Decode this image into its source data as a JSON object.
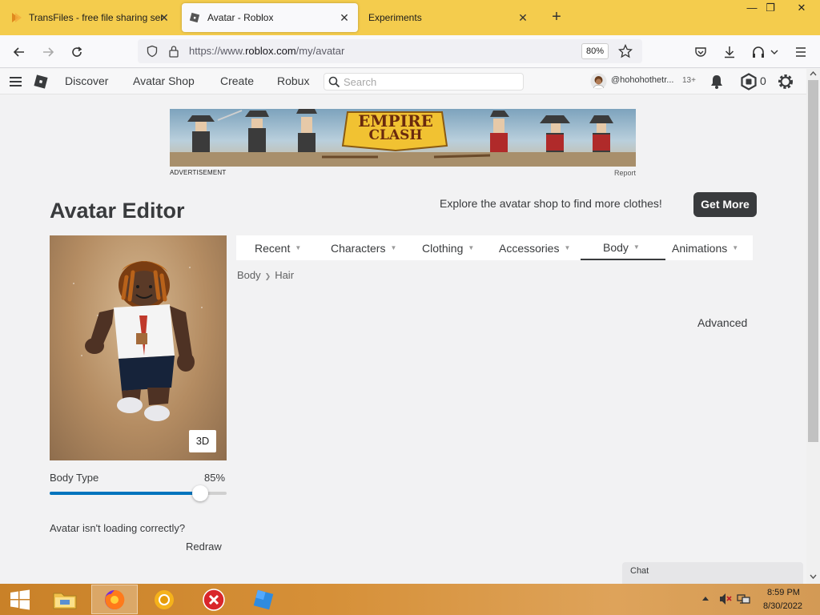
{
  "browser": {
    "tabs": [
      {
        "title": "TransFiles - free file sharing serv"
      },
      {
        "title": "Avatar - Roblox"
      },
      {
        "title": "Experiments"
      }
    ],
    "url_prefix": "https://www.",
    "url_host": "roblox.com",
    "url_path": "/my/avatar",
    "zoom": "80%"
  },
  "header": {
    "nav": [
      "Discover",
      "Avatar Shop",
      "Create",
      "Robux"
    ],
    "search_placeholder": "Search",
    "username": "@hohohothetr...",
    "age_badge": "13+",
    "robux_count": "0"
  },
  "ad": {
    "label": "ADVERTISEMENT",
    "report": "Report",
    "logo_line1": "EMPIRE",
    "logo_line2": "CLASH"
  },
  "editor": {
    "title": "Avatar Editor",
    "promo": "Explore the avatar shop to find more clothes!",
    "get_more": "Get More",
    "view_mode": "3D",
    "categories": [
      {
        "label": "Recent",
        "active": false
      },
      {
        "label": "Characters",
        "active": false
      },
      {
        "label": "Clothing",
        "active": false
      },
      {
        "label": "Accessories",
        "active": false
      },
      {
        "label": "Body",
        "active": true
      },
      {
        "label": "Animations",
        "active": false
      }
    ],
    "breadcrumb": [
      "Body",
      "Hair"
    ],
    "advanced": "Advanced",
    "body_type": {
      "label": "Body Type",
      "value_text": "85%",
      "value": 0.85
    },
    "loading_question": "Avatar isn't loading correctly?",
    "redraw": "Redraw"
  },
  "chat": {
    "label": "Chat"
  },
  "taskbar": {
    "time": "8:59 PM",
    "date": "8/30/2022"
  },
  "colors": {
    "tabbar": "#f4cc4d",
    "slider_fill": "#0074bd",
    "button_dark": "#393b3d"
  }
}
